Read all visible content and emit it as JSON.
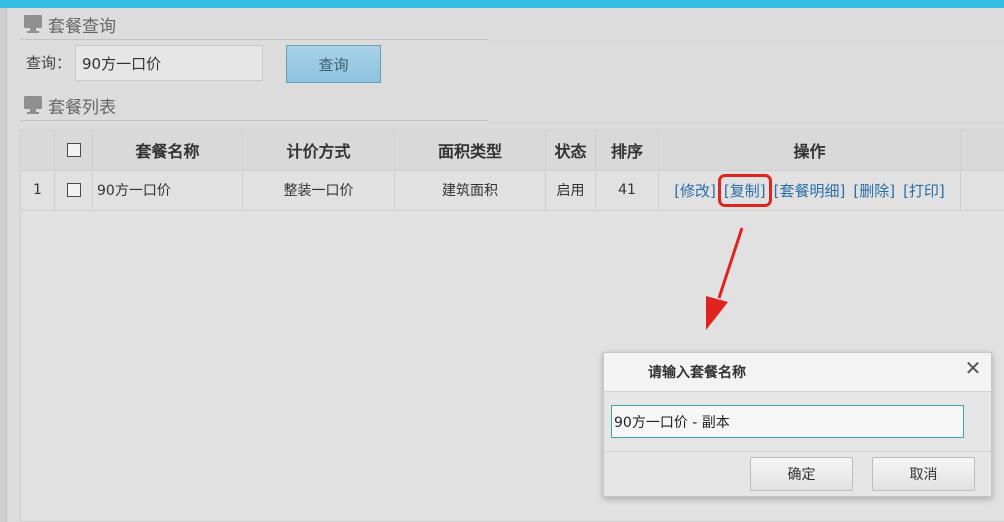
{
  "search_section": {
    "title": "套餐查询",
    "label": "查询：",
    "value": "90方一口价",
    "button": "查询"
  },
  "list_section": {
    "title": "套餐列表"
  },
  "table": {
    "columns": [
      "套餐名称",
      "计价方式",
      "面积类型",
      "状态",
      "排序",
      "操作"
    ],
    "rows": [
      {
        "num": "1",
        "name": "90方一口价",
        "pricing": "整装一口价",
        "area_type": "建筑面积",
        "status": "启用",
        "sort": "41",
        "ops": [
          "[修改]",
          "[复制]",
          "[套餐明细]",
          "[删除]",
          "[打印]"
        ]
      }
    ]
  },
  "dialog": {
    "title": "请输入套餐名称",
    "input_value": "90方一口价 - 副本",
    "ok": "确定",
    "cancel": "取消"
  },
  "colors": {
    "accent": "#34bde3",
    "highlight": "#e0231f",
    "link": "#2a6fa8"
  }
}
